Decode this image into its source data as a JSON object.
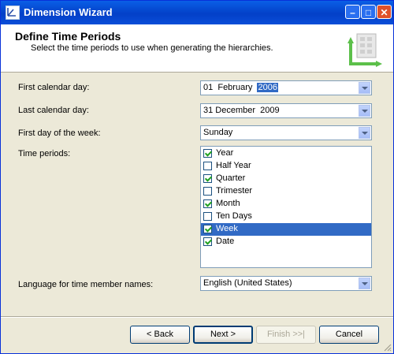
{
  "window": {
    "title": "Dimension Wizard"
  },
  "header": {
    "title": "Define Time Periods",
    "subtitle": "Select the time periods to use when generating the hierarchies."
  },
  "form": {
    "first_day": {
      "label": "First calendar day:",
      "date_part": "01  February  ",
      "year_part": "2006"
    },
    "last_day": {
      "label": "Last calendar day:",
      "value": "31 December  2009"
    },
    "week_start": {
      "label": "First day of the week:",
      "value": "Sunday"
    },
    "time_periods": {
      "label": "Time periods:",
      "items": [
        {
          "label": "Year",
          "checked": true,
          "selected": false
        },
        {
          "label": "Half Year",
          "checked": false,
          "selected": false
        },
        {
          "label": "Quarter",
          "checked": true,
          "selected": false
        },
        {
          "label": "Trimester",
          "checked": false,
          "selected": false
        },
        {
          "label": "Month",
          "checked": true,
          "selected": false
        },
        {
          "label": "Ten Days",
          "checked": false,
          "selected": false
        },
        {
          "label": "Week",
          "checked": true,
          "selected": true
        },
        {
          "label": "Date",
          "checked": true,
          "selected": false
        }
      ]
    },
    "language": {
      "label": "Language for time member names:",
      "value": "English (United States)"
    }
  },
  "buttons": {
    "back": "< Back",
    "next": "Next >",
    "finish": "Finish >>|",
    "cancel": "Cancel"
  }
}
